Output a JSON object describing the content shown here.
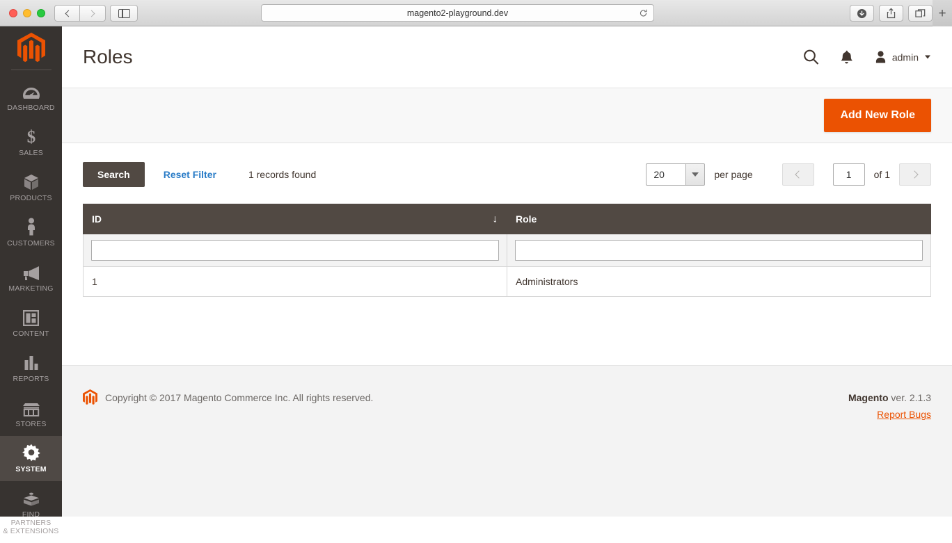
{
  "browser": {
    "url": "magento2-playground.dev",
    "reload_icon": "reload-icon",
    "back_icon": "chevron-left-icon",
    "forward_icon": "chevron-right-icon",
    "sidebar_icon": "sidebar-toggle-icon",
    "download_icon": "download-icon",
    "share_icon": "share-icon",
    "tabs_icon": "show-tabs-icon",
    "new_tab_label": "+"
  },
  "sidebar": {
    "logo": "magento-logo",
    "items": [
      {
        "label": "DASHBOARD",
        "icon": "dashboard-gauge-icon",
        "active": false
      },
      {
        "label": "SALES",
        "icon": "dollar-sign-icon",
        "active": false
      },
      {
        "label": "PRODUCTS",
        "icon": "box-icon",
        "active": false
      },
      {
        "label": "CUSTOMERS",
        "icon": "person-icon",
        "active": false
      },
      {
        "label": "MARKETING",
        "icon": "megaphone-icon",
        "active": false
      },
      {
        "label": "CONTENT",
        "icon": "layout-icon",
        "active": false
      },
      {
        "label": "REPORTS",
        "icon": "bar-chart-icon",
        "active": false
      },
      {
        "label": "STORES",
        "icon": "storefront-icon",
        "active": false
      },
      {
        "label": "SYSTEM",
        "icon": "gear-icon",
        "active": true
      },
      {
        "label": "FIND PARTNERS\n& EXTENSIONS",
        "label_line1": "FIND PARTNERS",
        "label_line2": "& EXTENSIONS",
        "icon": "puzzle-block-icon",
        "active": false
      }
    ]
  },
  "header": {
    "title": "Roles",
    "search_icon": "search-icon",
    "notifications_icon": "bell-icon",
    "avatar_icon": "user-avatar-icon",
    "admin_label": "admin",
    "caret_icon": "chevron-down-icon"
  },
  "actions": {
    "add_new_role_label": "Add New Role"
  },
  "toolbar": {
    "search_label": "Search",
    "reset_filter_label": "Reset Filter",
    "records_found": "1 records found",
    "per_page_value": "20",
    "per_page_label": "per page",
    "prev_icon": "chevron-left-icon",
    "next_icon": "chevron-right-icon",
    "current_page": "1",
    "of_label": "of 1"
  },
  "grid": {
    "columns": [
      {
        "key": "id",
        "label": "ID",
        "sorted": true,
        "sort_icon": "↓"
      },
      {
        "key": "role",
        "label": "Role",
        "sorted": false,
        "sort_icon": ""
      }
    ],
    "filters": {
      "id": "",
      "role": ""
    },
    "rows": [
      {
        "id": "1",
        "role": "Administrators"
      }
    ]
  },
  "footer": {
    "logo": "magento-logo-small",
    "copyright": "Copyright © 2017 Magento Commerce Inc. All rights reserved.",
    "brand": "Magento",
    "version": " ver. 2.1.3",
    "report_bugs_label": "Report Bugs"
  },
  "colors": {
    "accent_orange": "#eb5202",
    "sidebar_bg": "#373330",
    "sidebar_active_bg": "#4f4945",
    "table_header_bg": "#514943",
    "link_blue": "#2a7cc7"
  }
}
